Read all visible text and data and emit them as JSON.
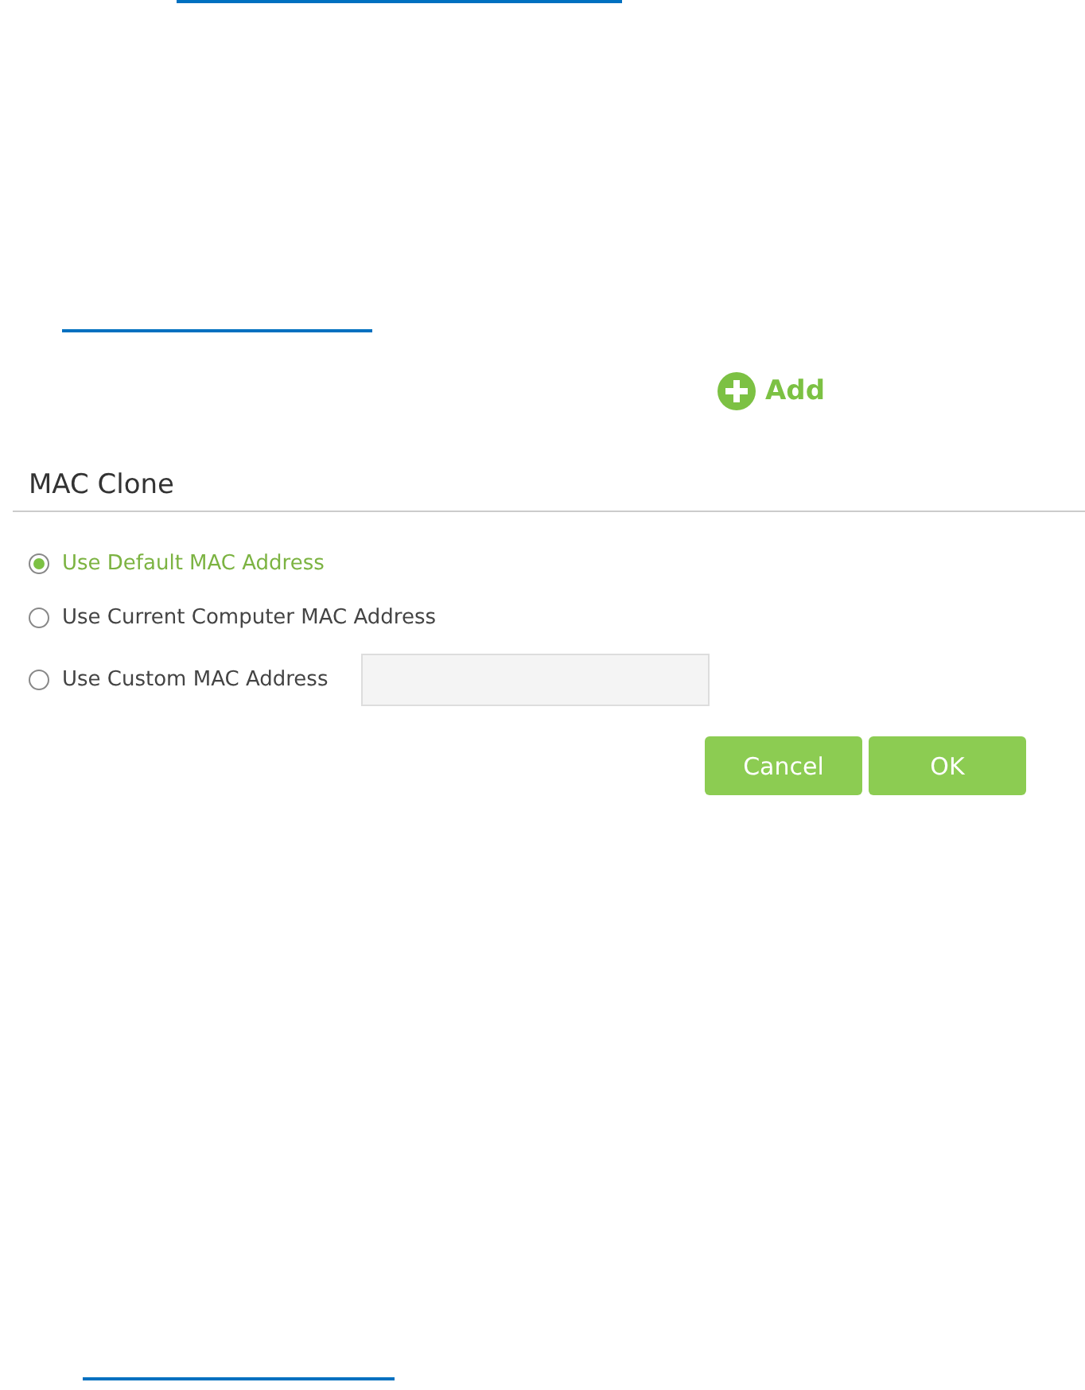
{
  "add_button": {
    "label": "Add"
  },
  "mac_clone": {
    "title": "MAC Clone",
    "options": [
      {
        "label": "Use Default MAC Address",
        "selected": true,
        "kind": "plain"
      },
      {
        "label": "Use Current Computer MAC Address",
        "selected": false,
        "kind": "plain"
      },
      {
        "label": "Use Custom MAC Address",
        "selected": false,
        "kind": "custom"
      }
    ],
    "buttons": [
      {
        "label": "Cancel"
      },
      {
        "label": "OK"
      }
    ]
  }
}
